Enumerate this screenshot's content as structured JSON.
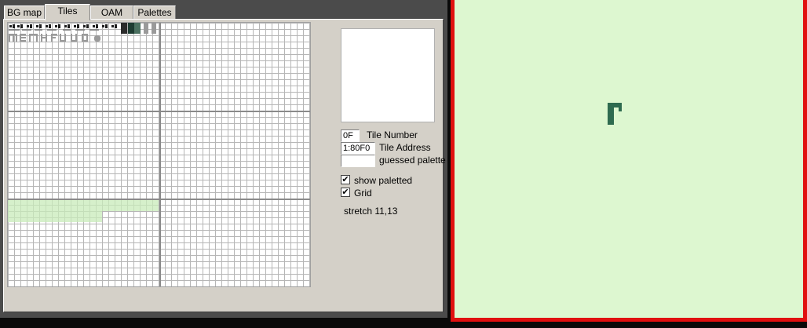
{
  "tabs": [
    {
      "label": "BG map",
      "active": false
    },
    {
      "label": "Tiles",
      "active": true
    },
    {
      "label": "OAM",
      "active": false
    },
    {
      "label": "Palettes",
      "active": false
    }
  ],
  "tile_info": {
    "tile_number_value": "0F",
    "tile_number_label": "Tile Number",
    "tile_address_value": "1:80F0",
    "tile_address_label": "Tile Address",
    "guessed_palette_value": "",
    "guessed_palette_label": "guessed palette"
  },
  "options": {
    "show_paletted_label": "show paletted",
    "show_paletted_checked": true,
    "grid_label": "Grid",
    "grid_checked": true,
    "stretch_text": "stretch 11,13"
  },
  "colors": {
    "screen_bg": "#ddf7d0",
    "screen_border": "#e01010",
    "sprite": "#2e6b4f",
    "tile_dark": "#1e3c32",
    "tile_highlight": "#c8ebb9"
  },
  "icons": {
    "checkbox_mark": "✔"
  }
}
